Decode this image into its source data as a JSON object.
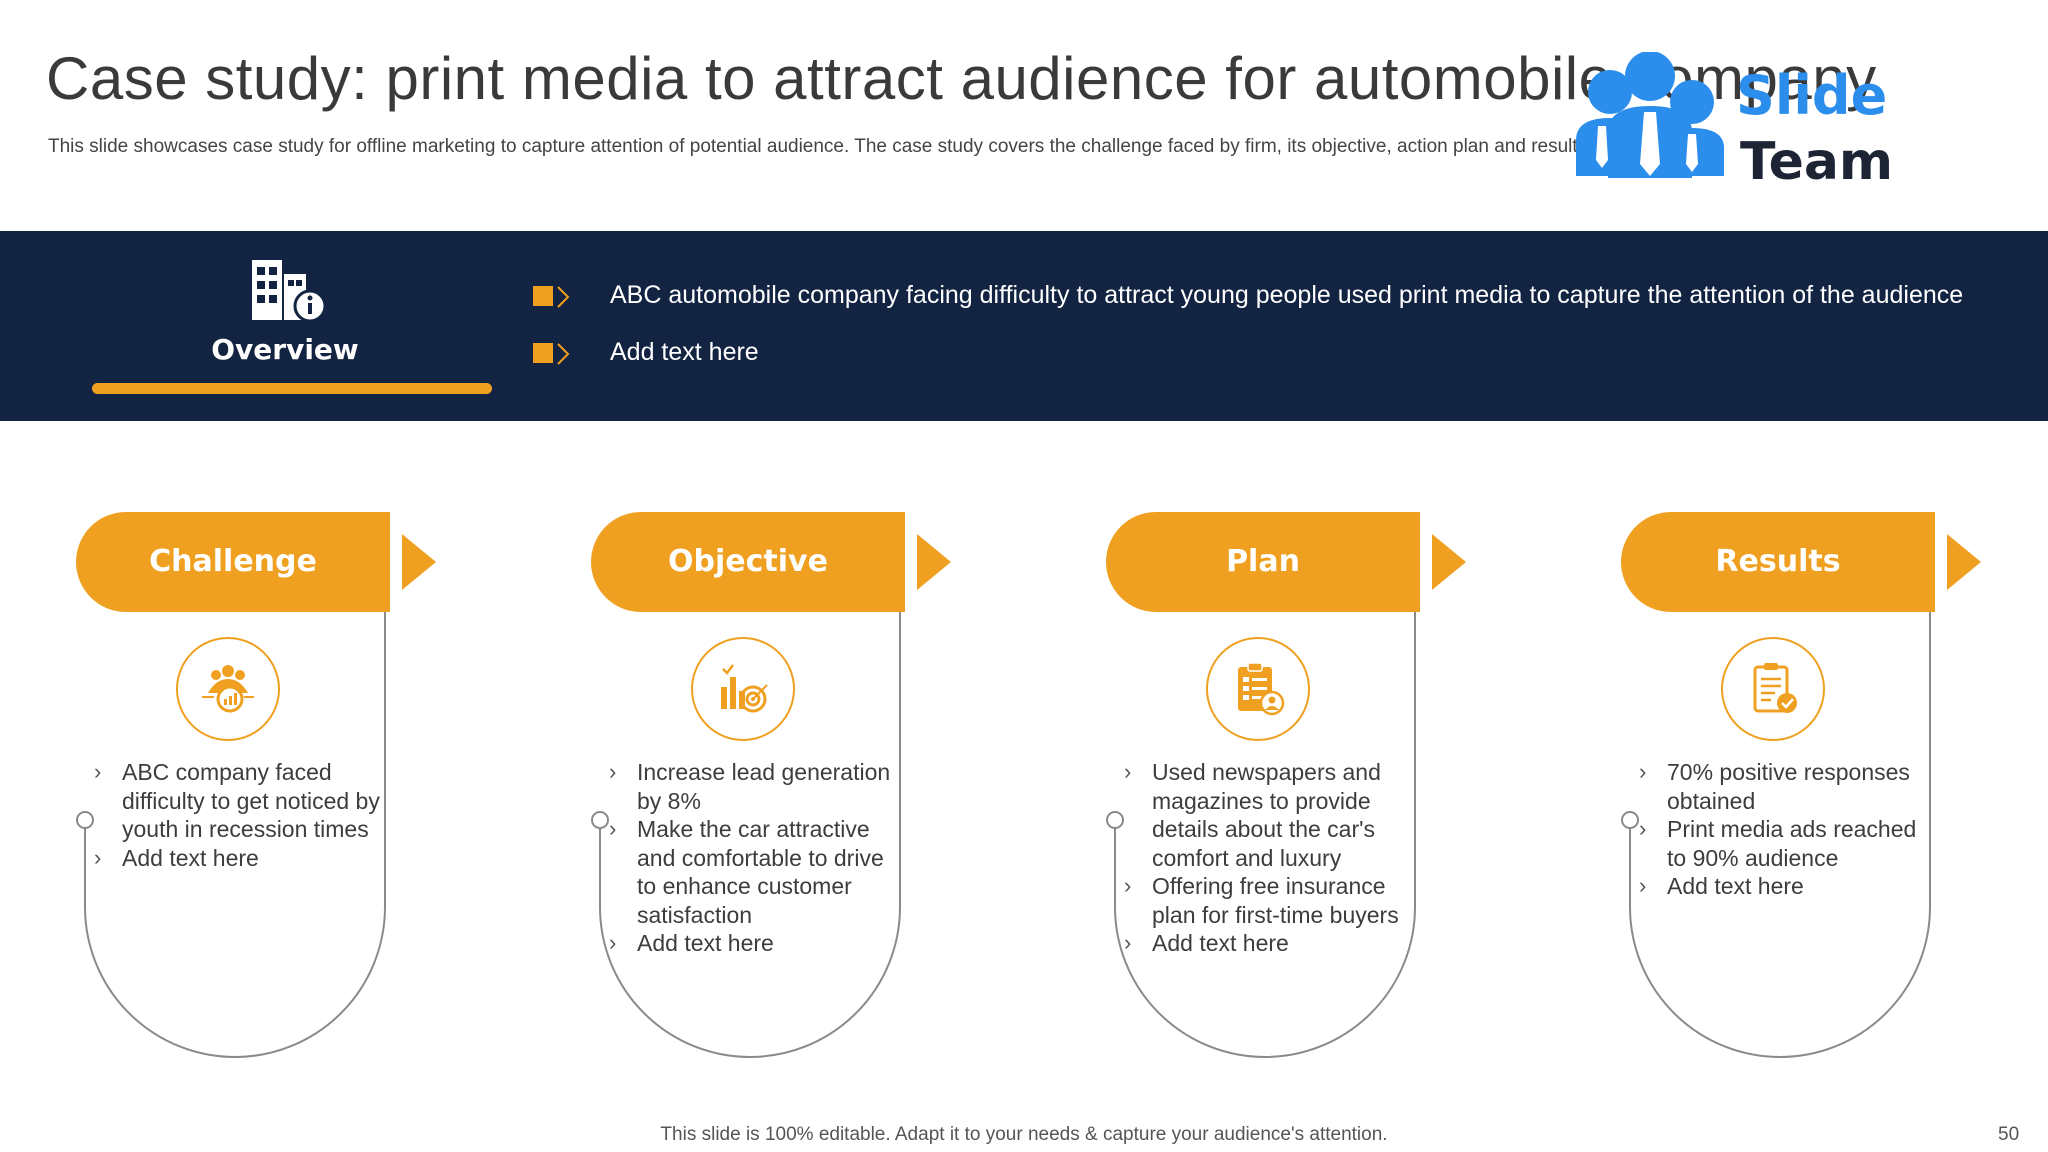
{
  "header": {
    "title": "Case study: print media to attract audience for automobile company",
    "subtitle": "This slide showcases case study for offline marketing to capture attention of potential audience. The case study covers the challenge faced by firm, its objective, action plan and results"
  },
  "logo": {
    "line1": "Slide",
    "line2": "Team",
    "color": "#2b8eec"
  },
  "overview": {
    "icon": "building-info-icon",
    "label": "Overview",
    "bullets": [
      "ABC automobile company facing difficulty to attract young people used print media to capture the attention of the audience",
      "Add text here"
    ]
  },
  "cards": [
    {
      "title": "Challenge",
      "icon": "team-growth-icon",
      "bullets": [
        "ABC company faced difficulty to get noticed by youth in recession times",
        "Add text here"
      ]
    },
    {
      "title": "Objective",
      "icon": "chart-target-icon",
      "bullets": [
        "Increase lead generation by 8%",
        "Make the car attractive and comfortable to drive to enhance customer satisfaction",
        "Add text here"
      ]
    },
    {
      "title": "Plan",
      "icon": "clipboard-user-icon",
      "bullets": [
        "Used newspapers and magazines to provide details about the car's comfort and luxury",
        "Offering free insurance plan for first-time buyers",
        "Add text here"
      ]
    },
    {
      "title": "Results",
      "icon": "report-check-icon",
      "bullets": [
        "70% positive responses obtained",
        "Print media ads reached to 90% audience",
        "Add text here"
      ]
    }
  ],
  "footer": {
    "note": "This slide is 100% editable. Adapt it to your needs & capture your audience's attention.",
    "page": "50"
  },
  "colors": {
    "navy": "#132442",
    "orange": "#f0a020"
  }
}
